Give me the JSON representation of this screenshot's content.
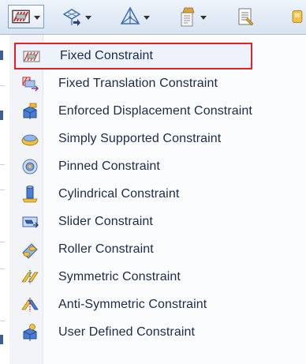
{
  "toolbar": {
    "buttons": [
      {
        "name": "fixed-constraint",
        "icon": "fixed-constraint-icon",
        "has_dropdown": true,
        "active": true
      },
      {
        "name": "load",
        "icon": "load-icon",
        "has_dropdown": true
      },
      {
        "name": "mesh",
        "icon": "mesh-icon",
        "has_dropdown": true
      },
      {
        "name": "material",
        "icon": "material-icon",
        "has_dropdown": true
      },
      {
        "name": "report",
        "icon": "report-icon",
        "has_dropdown": false
      }
    ]
  },
  "menu": {
    "items": [
      {
        "label": "Fixed Constraint",
        "icon": "fixed-constraint-icon",
        "selected": true
      },
      {
        "label": "Fixed Translation Constraint",
        "icon": "fixed-translation-icon"
      },
      {
        "label": "Enforced Displacement Constraint",
        "icon": "enforced-displacement-icon"
      },
      {
        "label": "Simply Supported Constraint",
        "icon": "simply-supported-icon"
      },
      {
        "label": "Pinned Constraint",
        "icon": "pinned-icon"
      },
      {
        "label": "Cylindrical Constraint",
        "icon": "cylindrical-icon"
      },
      {
        "label": "Slider Constraint",
        "icon": "slider-icon"
      },
      {
        "label": "Roller Constraint",
        "icon": "roller-icon"
      },
      {
        "label": "Symmetric Constraint",
        "icon": "symmetric-icon"
      },
      {
        "label": "Anti-Symmetric Constraint",
        "icon": "anti-symmetric-icon"
      },
      {
        "label": "User Defined Constraint",
        "icon": "user-defined-icon"
      }
    ]
  },
  "colors": {
    "selection_border": "#e3212b",
    "menu_text": "#1b2b48",
    "toolbar_bg": "#dde7f3"
  }
}
